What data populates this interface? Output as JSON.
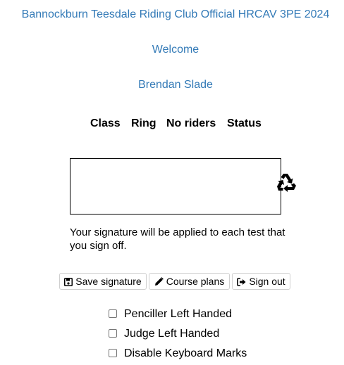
{
  "header": {
    "event_title": "Bannockburn Teesdale Riding Club Official HRCAV 3PE 2024",
    "welcome": "Welcome",
    "judge_name": "Brendan Slade"
  },
  "table": {
    "columns": [
      "Class",
      "Ring",
      "No riders",
      "Status"
    ]
  },
  "signature": {
    "note": "Your signature will be applied to each test that you sign off.",
    "clear_icon": "recycle-icon"
  },
  "buttons": {
    "save_signature": "Save signature",
    "course_plans": "Course plans",
    "sign_out": "Sign out"
  },
  "options": [
    {
      "label": "Penciller Left Handed",
      "checked": false
    },
    {
      "label": "Judge Left Handed",
      "checked": false
    },
    {
      "label": "Disable Keyboard Marks",
      "checked": false
    }
  ],
  "colors": {
    "link_blue": "#337ab7"
  }
}
